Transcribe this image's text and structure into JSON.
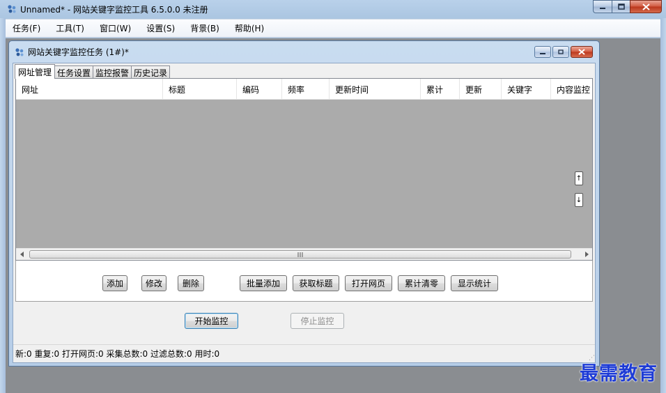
{
  "app": {
    "title": "Unnamed* - 网站关键字监控工具 6.5.0.0  未注册",
    "icon": "app-logo-icon"
  },
  "menu": {
    "items": [
      {
        "label": "任务(F)"
      },
      {
        "label": "工具(T)"
      },
      {
        "label": "窗口(W)"
      },
      {
        "label": "设置(S)"
      },
      {
        "label": "背景(B)"
      },
      {
        "label": "帮助(H)"
      }
    ]
  },
  "child_window": {
    "title": "网站关键字监控任务  (1#)*",
    "tabs": [
      {
        "label": "网址管理",
        "active": true
      },
      {
        "label": "任务设置",
        "active": false
      },
      {
        "label": "监控报警",
        "active": false
      },
      {
        "label": "历史记录",
        "active": false
      }
    ],
    "table": {
      "columns": [
        "网址",
        "标题",
        "编码",
        "频率",
        "更新时间",
        "累计",
        "更新",
        "关键字",
        "内容监控"
      ],
      "rows": []
    },
    "reorder": {
      "up": "↑",
      "down": "↓"
    },
    "actions": {
      "add": "添加",
      "edit": "修改",
      "delete": "删除",
      "batch_add": "批量添加",
      "fetch_title": "获取标题",
      "open_page": "打开网页",
      "reset_count": "累计清零",
      "show_stats": "显示统计"
    },
    "controls": {
      "start": "开始监控",
      "stop": "停止监控"
    },
    "status": "新:0  重复:0  打开网页:0  采集总数:0  过滤总数:0  用时:0"
  },
  "watermark": "最需教育",
  "colors": {
    "list_background": "#ababab",
    "titlebar": "#b9d1ea",
    "close_button": "#c8452a",
    "watermark": "#1d3bd6"
  }
}
